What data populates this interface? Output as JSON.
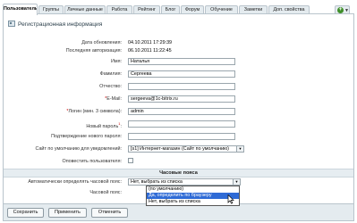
{
  "tabs": [
    "Пользователь",
    "Группы",
    "Личные данные",
    "Работа",
    "Рейтинг",
    "Блог",
    "Форум",
    "Обучение",
    "Заметки",
    "Доп. свойства"
  ],
  "panel": {
    "title": "Регистрационная информация"
  },
  "info": [
    {
      "label": "Дата обновления:",
      "value": "04.10.2011 17:29:39"
    },
    {
      "label": "Последняя авторизация:",
      "value": "06.10.2011 11:22:45"
    }
  ],
  "form": {
    "first_name": {
      "label": "Имя:",
      "value": "Наталья"
    },
    "last_name": {
      "label": "Фамилия:",
      "value": "Сергеева"
    },
    "middle_name": {
      "label": "Отчество:",
      "value": ""
    },
    "email": {
      "label_req": "*",
      "label": "E-Mail:",
      "value": "sergeeva@1c-bitrix.ru"
    },
    "login": {
      "label_req": "*",
      "label": "Логин (мин. 3 символа):",
      "value": "admin"
    },
    "new_password": {
      "label": "Новый пароль",
      "label_sup": "1",
      "label_end": ":",
      "value": ""
    },
    "confirm_password": {
      "label": "Подтверждение нового пароля:",
      "value": ""
    },
    "notify_site": {
      "label": "Сайт по умолчанию для уведомлений:",
      "value": "[s1] Интернет-магазин (Сайт по умолчанию)"
    },
    "notify_user": {
      "label": "Оповестить пользователя:",
      "checked": false
    }
  },
  "timezones": {
    "section_title": "Часовые пояса",
    "auto_label": "Автоматически определять часовой пояс:",
    "auto_value": "Нет, выбрать из списка",
    "zone_label": "Часовой пояс:",
    "options": [
      "(по умолчанию)",
      "Да, определить по браузеру",
      "Нет, выбрать из списка"
    ],
    "highlighted_option": 1
  },
  "buttons": {
    "save": "Сохранить",
    "apply": "Применить",
    "cancel": "Отменить"
  },
  "colors": {
    "tab_bg": "#e4ebef",
    "border": "#b9c4cc",
    "highlight": "#2f6bd6",
    "required": "#cc0000"
  }
}
